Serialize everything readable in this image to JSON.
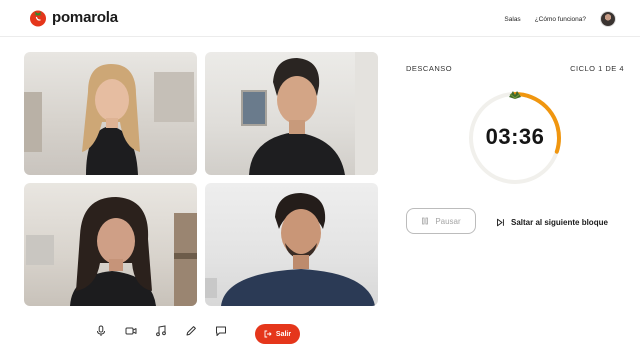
{
  "brand": {
    "name": "pomarola",
    "icon": "tomato-icon",
    "accent": "#e5361b"
  },
  "nav": {
    "rooms_label": "Salas",
    "how_label": "¿Cómo funciona?",
    "avatar_icon": "user-avatar"
  },
  "participants": [
    {
      "id": "p1"
    },
    {
      "id": "p2"
    },
    {
      "id": "p3"
    },
    {
      "id": "p4"
    }
  ],
  "controls": {
    "icons": [
      "microphone-icon",
      "camera-icon",
      "music-note-icon",
      "pencil-icon",
      "chat-bubble-icon"
    ],
    "exit_label": "Salir",
    "exit_color": "#e5361b"
  },
  "timer": {
    "phase_label": "DESCANSO",
    "cycle_label": "CICLO 1 DE 4",
    "time": "03:36",
    "progress_fraction": 0.3,
    "progress_color": "#f0960f",
    "track_color": "#f1f0ec",
    "pause_label": "Pausar",
    "skip_label": "Saltar al siguiente bloque"
  }
}
